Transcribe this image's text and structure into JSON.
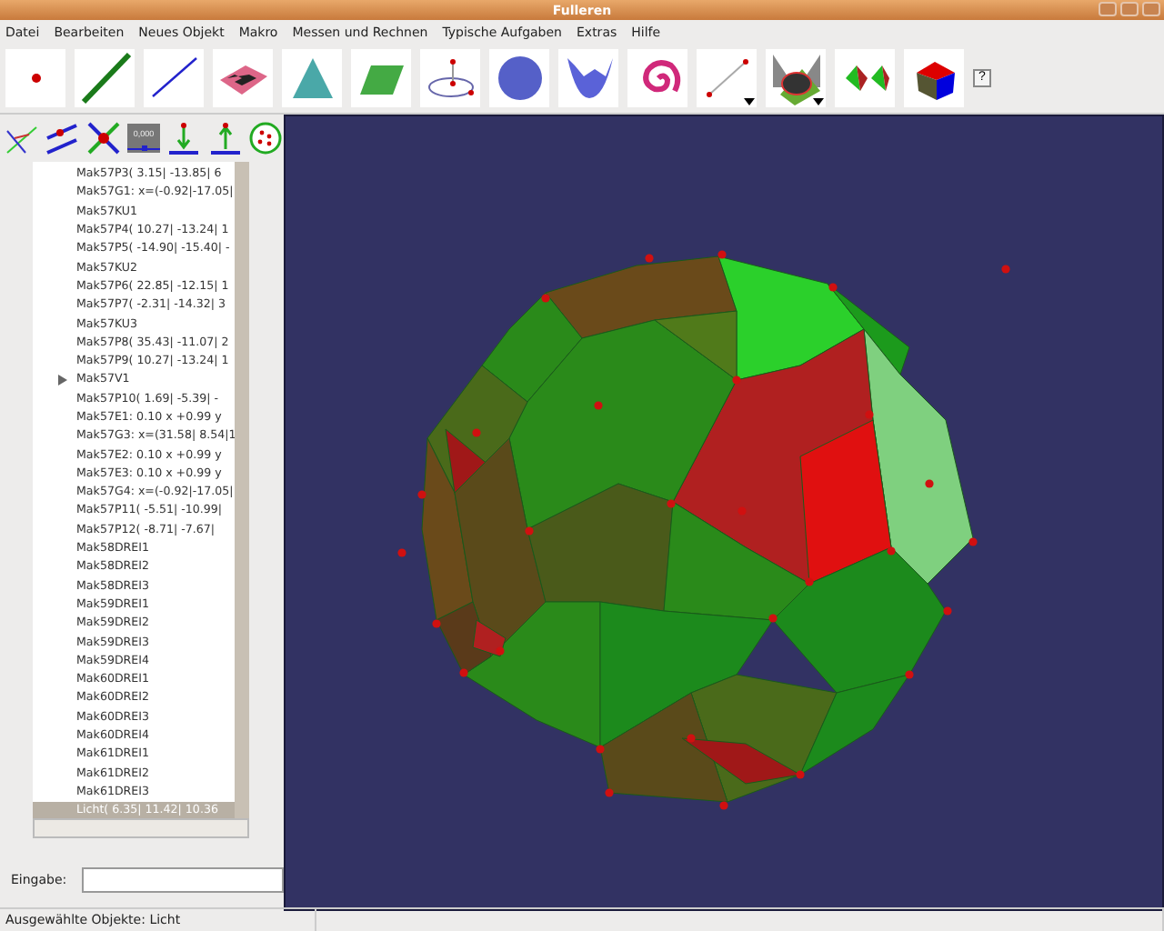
{
  "window": {
    "title": "Fulleren"
  },
  "menu": [
    "Datei",
    "Bearbeiten",
    "Neues Objekt",
    "Makro",
    "Messen und Rechnen",
    "Typische Aufgaben",
    "Extras",
    "Hilfe"
  ],
  "toolbar": [
    {
      "kind": "point",
      "dropdown": false
    },
    {
      "kind": "thick-line",
      "dropdown": false
    },
    {
      "kind": "segment",
      "dropdown": false
    },
    {
      "kind": "checker-plane",
      "dropdown": false
    },
    {
      "kind": "triangle",
      "dropdown": false
    },
    {
      "kind": "parallelogram",
      "dropdown": false
    },
    {
      "kind": "circle",
      "dropdown": false
    },
    {
      "kind": "sphere",
      "dropdown": false
    },
    {
      "kind": "surface",
      "dropdown": false
    },
    {
      "kind": "spiral",
      "dropdown": false
    },
    {
      "kind": "vector",
      "dropdown": true
    },
    {
      "kind": "intersection",
      "dropdown": true
    },
    {
      "kind": "pyramids",
      "dropdown": false
    },
    {
      "kind": "cube",
      "dropdown": false
    }
  ],
  "help_button": "?",
  "side_tools": [
    {
      "kind": "angle"
    },
    {
      "kind": "parallel"
    },
    {
      "kind": "cross"
    },
    {
      "kind": "slider",
      "label": "0,000"
    },
    {
      "kind": "down"
    },
    {
      "kind": "up"
    },
    {
      "kind": "cloud"
    }
  ],
  "tree": [
    {
      "label": "Mak57P3(  3.15| -13.85|  6",
      "selected": false,
      "expandable": false
    },
    {
      "label": "Mak57G1: x=(-0.92|-17.05|",
      "selected": false,
      "expandable": false
    },
    {
      "label": "Mak57KU1",
      "selected": false,
      "expandable": false
    },
    {
      "label": "Mak57P4(  10.27| -13.24|  1",
      "selected": false,
      "expandable": false
    },
    {
      "label": "Mak57P5( -14.90| -15.40|  -",
      "selected": false,
      "expandable": false
    },
    {
      "label": "Mak57KU2",
      "selected": false,
      "expandable": false
    },
    {
      "label": "Mak57P6(  22.85| -12.15|  1",
      "selected": false,
      "expandable": false
    },
    {
      "label": "Mak57P7(  -2.31| -14.32|  3",
      "selected": false,
      "expandable": false
    },
    {
      "label": "Mak57KU3",
      "selected": false,
      "expandable": false
    },
    {
      "label": "Mak57P8(  35.43| -11.07|  2",
      "selected": false,
      "expandable": false
    },
    {
      "label": "Mak57P9(  10.27| -13.24|  1",
      "selected": false,
      "expandable": false
    },
    {
      "label": "Mak57V1",
      "selected": false,
      "expandable": true
    },
    {
      "label": "Mak57P10(   1.69|  -5.39|  -",
      "selected": false,
      "expandable": false
    },
    {
      "label": "Mak57E1:   0.10 x  +0.99 y",
      "selected": false,
      "expandable": false
    },
    {
      "label": "Mak57G3: x=(31.58| 8.54|1",
      "selected": false,
      "expandable": false
    },
    {
      "label": "Mak57E2:   0.10 x  +0.99 y",
      "selected": false,
      "expandable": false
    },
    {
      "label": "Mak57E3:   0.10 x  +0.99 y",
      "selected": false,
      "expandable": false
    },
    {
      "label": "Mak57G4: x=(-0.92|-17.05|",
      "selected": false,
      "expandable": false
    },
    {
      "label": "Mak57P11(  -5.51| -10.99|",
      "selected": false,
      "expandable": false
    },
    {
      "label": "Mak57P12(  -8.71|  -7.67|",
      "selected": false,
      "expandable": false
    },
    {
      "label": "Mak58DREI1",
      "selected": false,
      "expandable": false
    },
    {
      "label": "Mak58DREI2",
      "selected": false,
      "expandable": false
    },
    {
      "label": "Mak58DREI3",
      "selected": false,
      "expandable": false
    },
    {
      "label": "Mak59DREI1",
      "selected": false,
      "expandable": false
    },
    {
      "label": "Mak59DREI2",
      "selected": false,
      "expandable": false
    },
    {
      "label": "Mak59DREI3",
      "selected": false,
      "expandable": false
    },
    {
      "label": "Mak59DREI4",
      "selected": false,
      "expandable": false
    },
    {
      "label": "Mak60DREI1",
      "selected": false,
      "expandable": false
    },
    {
      "label": "Mak60DREI2",
      "selected": false,
      "expandable": false
    },
    {
      "label": "Mak60DREI3",
      "selected": false,
      "expandable": false
    },
    {
      "label": "Mak60DREI4",
      "selected": false,
      "expandable": false
    },
    {
      "label": "Mak61DREI1",
      "selected": false,
      "expandable": false
    },
    {
      "label": "Mak61DREI2",
      "selected": false,
      "expandable": false
    },
    {
      "label": "Mak61DREI3",
      "selected": false,
      "expandable": false
    },
    {
      "label": "Licht(   6.35|  11.42|  10.36",
      "selected": true,
      "expandable": false
    }
  ],
  "input": {
    "label": "Eingabe:"
  },
  "status_bar": [
    "Ausgewählte Objekte: Licht"
  ]
}
